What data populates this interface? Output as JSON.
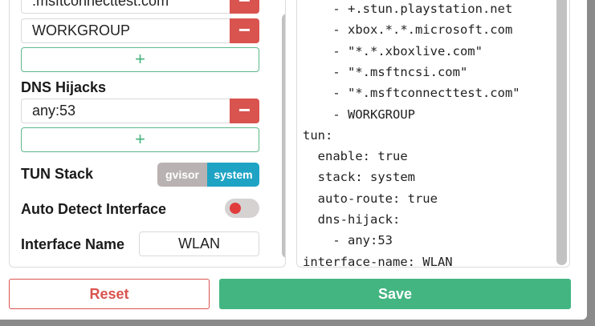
{
  "dns_filter": {
    "items": [
      ".msftconnecttest.com",
      "WORKGROUP"
    ],
    "remove_label": "−",
    "add_label": "+"
  },
  "dns_hijacks": {
    "label": "DNS Hijacks",
    "items": [
      "any:53"
    ],
    "remove_label": "−",
    "add_label": "+"
  },
  "tun_stack": {
    "label": "TUN Stack",
    "options": [
      "gvisor",
      "system"
    ],
    "selected": "system"
  },
  "auto_detect": {
    "label": "Auto Detect Interface",
    "enabled": false
  },
  "interface_name": {
    "label": "Interface Name",
    "value": "WLAN"
  },
  "preview": {
    "lines": [
      "    - +.stun.playstation.net",
      "    - xbox.*.*.microsoft.com",
      "    - \"*.*.xboxlive.com\"",
      "    - \"*.msftncsi.com\"",
      "    - \"*.msftconnecttest.com\"",
      "    - WORKGROUP",
      "tun:",
      "  enable: true",
      "  stack: system",
      "  auto-route: true",
      "  dns-hijack:",
      "    - any:53",
      "interface-name: WLAN"
    ]
  },
  "footer": {
    "reset_label": "Reset",
    "save_label": "Save"
  },
  "colors": {
    "danger": "#d9534f",
    "success": "#43b581",
    "accent": "#1fa3c4"
  }
}
